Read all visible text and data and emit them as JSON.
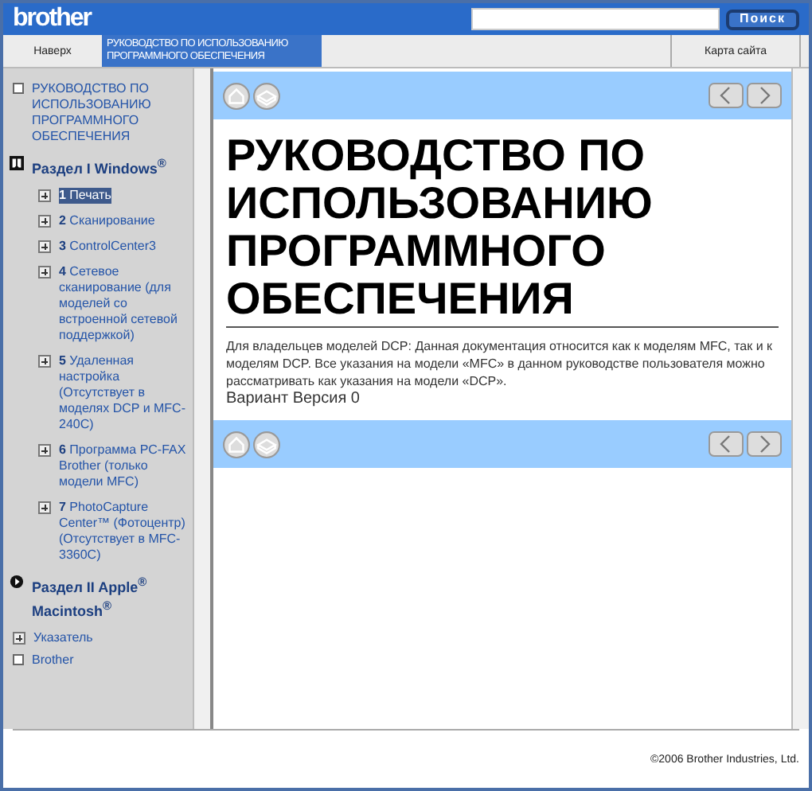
{
  "header": {
    "logo": "brother",
    "search_button": "Поиск"
  },
  "nav": [
    {
      "label": "Наверх",
      "selected": false
    },
    {
      "label": "РУКОВОДСТВО ПО ИСПОЛЬЗОВАНИЮ ПРОГРАММНОГО ОБЕСПЕЧЕНИЯ",
      "selected": true
    },
    {
      "label": "Карта сайта",
      "selected": false
    }
  ],
  "sidebar": {
    "items": [
      {
        "kind": "page",
        "label": "РУКОВОДСТВО ПО ИСПОЛЬЗОВАНИЮ ПРОГРАММНОГО ОБЕСПЕЧЕНИЯ"
      },
      {
        "kind": "section",
        "label": "Раздел I Windows$^{®}$",
        "expanded": true,
        "children": [
          {
            "number": "1",
            "label": "Печать",
            "selected": true
          },
          {
            "number": "2",
            "label": "Сканирование",
            "selected": false
          },
          {
            "number": "3",
            "label": "ControlCenter3",
            "selected": false
          },
          {
            "number": "4",
            "label": "Сетевое сканирование (для моделей со встроенной сетевой поддержкой)",
            "selected": false
          },
          {
            "number": "5",
            "label": "Удаленная настройка (Отсутствует в моделях DCP и MFC-240C)",
            "selected": false
          },
          {
            "number": "6",
            "label": "Программа PC-FAX Brother (только модели MFC)",
            "selected": false
          },
          {
            "number": "7",
            "label": "PhotoCapture Center™ (Фотоцентр) (Отсутствует в MFC-3360C)",
            "selected": false
          }
        ]
      },
      {
        "kind": "section",
        "label": "Раздел II Apple$^{®}$ Macintosh$^{®}$",
        "expanded": false
      },
      {
        "kind": "group",
        "label": "Указатель",
        "expanded": false
      },
      {
        "kind": "page",
        "label": "Brother"
      }
    ]
  },
  "content": {
    "title": "РУКОВОДСТВО ПО ИСПОЛЬЗОВАНИЮ ПРОГРАММНОГО ОБЕСПЕЧЕНИЯ",
    "note": "Для владельцев моделей DCP: Данная документация относится как к моделям MFC, так и к моделям DCP. Все указания на модели «MFC» в данном руководстве пользователя можно рассматривать как указания на модели «DCP».",
    "version": "Вариант Версия 0"
  },
  "footer": "©2006 Brother Industries, Ltd."
}
